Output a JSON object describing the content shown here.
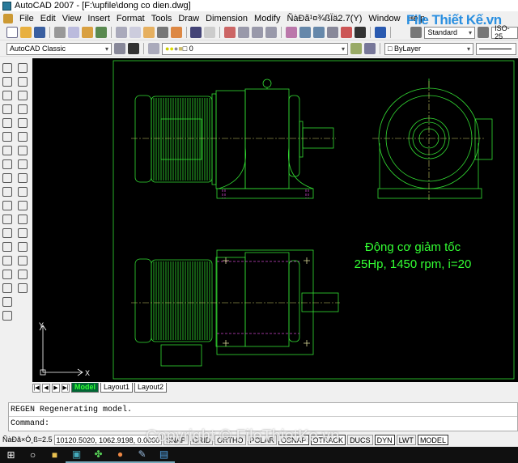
{
  "title": "AutoCAD 2007 - [F:\\upfile\\dong co dien.dwg]",
  "menu": [
    "File",
    "Edit",
    "View",
    "Insert",
    "Format",
    "Tools",
    "Draw",
    "Dimension",
    "Modify",
    "ÑàÐã¹¤¾ßÏä2.7(Y)",
    "Window",
    "Help"
  ],
  "logo": "File Thiết Kế.vn",
  "toolbar": {
    "text_style": "Standard",
    "dim_style": "ISO-25",
    "workspace": "AutoCAD Classic",
    "layer": "0",
    "color": "ByLayer"
  },
  "drawing": {
    "label_line1": "Động cơ giảm tốc",
    "label_line2": "25Hp, 1450 rpm, i=20",
    "ucs_x": "X",
    "ucs_y": "Y",
    "line_color": "#33dd33",
    "text_color": "#33ff33",
    "hidden_color": "#cc44cc"
  },
  "tabs": [
    "Model",
    "Layout1",
    "Layout2"
  ],
  "active_tab": "Model",
  "command": {
    "history": "REGEN Regenerating model.",
    "prompt": "Command:"
  },
  "status": {
    "scale_text": "ÑàÐã×Ó¸ß=2.5",
    "coords": "10120.5020, 1062.9198, 0.0000",
    "toggles": [
      "SNAP",
      "GRID",
      "ORTHO",
      "POLAR",
      "OSNAP",
      "OTRACK",
      "DUCS",
      "DYN",
      "LWT",
      "MODEL"
    ]
  },
  "watermark": "Copyright © FileThietKe.vn",
  "taskbar": [
    "windows-start",
    "search",
    "file-explorer",
    "autocad",
    "app-clover",
    "chrome",
    "app-paint",
    "app-window"
  ]
}
